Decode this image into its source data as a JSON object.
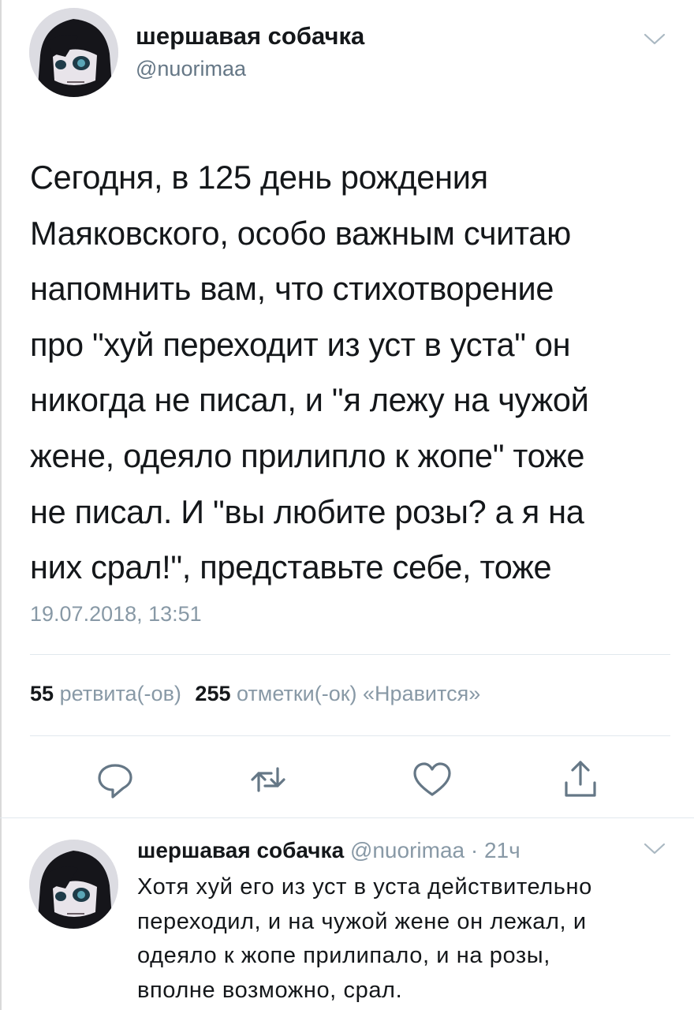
{
  "main_tweet": {
    "author_name": "шершавая собачка",
    "author_handle": "@nuorimaa",
    "text_lines": [
      "Сегодня, в 125 день рождения",
      "Маяковского, особо важным считаю",
      "напомнить вам, что стихотворение",
      "про \"хуй переходит из уст в уста\" он",
      "никогда не писал, и \"я лежу на чужой",
      "жене, одеяло прилипло к жопе\" тоже",
      "не писал. И \"вы любите розы? а я на",
      "них срал!\", представьте себе, тоже"
    ],
    "timestamp": "19.07.2018, 13:51",
    "stats": {
      "retweets_count": "55",
      "retweets_label": "ретвита(-ов)",
      "likes_count": "255",
      "likes_label": "отметки(-ок) «Нравится»"
    },
    "actions": [
      "reply-icon",
      "retweet-icon",
      "like-icon",
      "share-icon"
    ]
  },
  "reply_tweet": {
    "author_name": "шершавая собачка",
    "meta": "@nuorimaa · 21ч",
    "text_lines": [
      "Хотя хуй его из уст в уста действительно",
      "переходил, и на чужой жене он лежал, и",
      "одеяло к жопе прилипало, и на розы,",
      "вполне возможно, срал."
    ]
  },
  "colors": {
    "text_primary": "#14171a",
    "text_secondary": "#8899a6",
    "divider": "#e1e8ed",
    "icon": "#657786"
  }
}
